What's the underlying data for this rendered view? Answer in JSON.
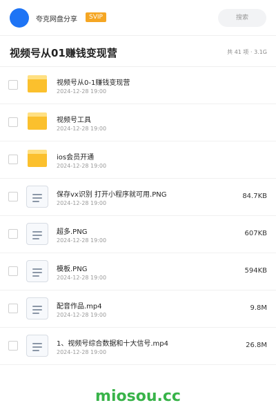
{
  "header": {
    "user_name": "夸克网盘分享",
    "badge": "SVIP",
    "search_placeholder": "搜索"
  },
  "folder": {
    "title": "视频号从01赚钱变现营",
    "summary": "共 41 项 · 3.1G"
  },
  "files": [
    {
      "name": "视频号从0-1赚钱变现营",
      "date": "2024-12-28 19:00",
      "size": "",
      "type": "folder"
    },
    {
      "name": "视频号工具",
      "date": "2024-12-28 19:00",
      "size": "",
      "type": "folder"
    },
    {
      "name": "ios会员开通",
      "date": "2024-12-28 19:00",
      "size": "",
      "type": "folder"
    },
    {
      "name": "保存vx识别 打开小程序就可用.PNG",
      "date": "2024-12-28 19:00",
      "size": "84.7KB",
      "type": "file"
    },
    {
      "name": "超多.PNG",
      "date": "2024-12-28 19:00",
      "size": "607KB",
      "type": "file"
    },
    {
      "name": "模板.PNG",
      "date": "2024-12-28 19:00",
      "size": "594KB",
      "type": "file"
    },
    {
      "name": "配音作品.mp4",
      "date": "2024-12-28 19:00",
      "size": "9.8M",
      "type": "file"
    },
    {
      "name": "1、视频号综合数据和十大信号.mp4",
      "date": "2024-12-28 19:00",
      "size": "26.8M",
      "type": "file"
    }
  ],
  "watermark": "miosou.cc",
  "colors": {
    "avatar": "#1e74f5",
    "badge": "#f5a623",
    "folder": "#fbc02d",
    "watermark": "#38b349"
  },
  "icons": {
    "folder": "folder-icon",
    "file": "document-icon"
  }
}
